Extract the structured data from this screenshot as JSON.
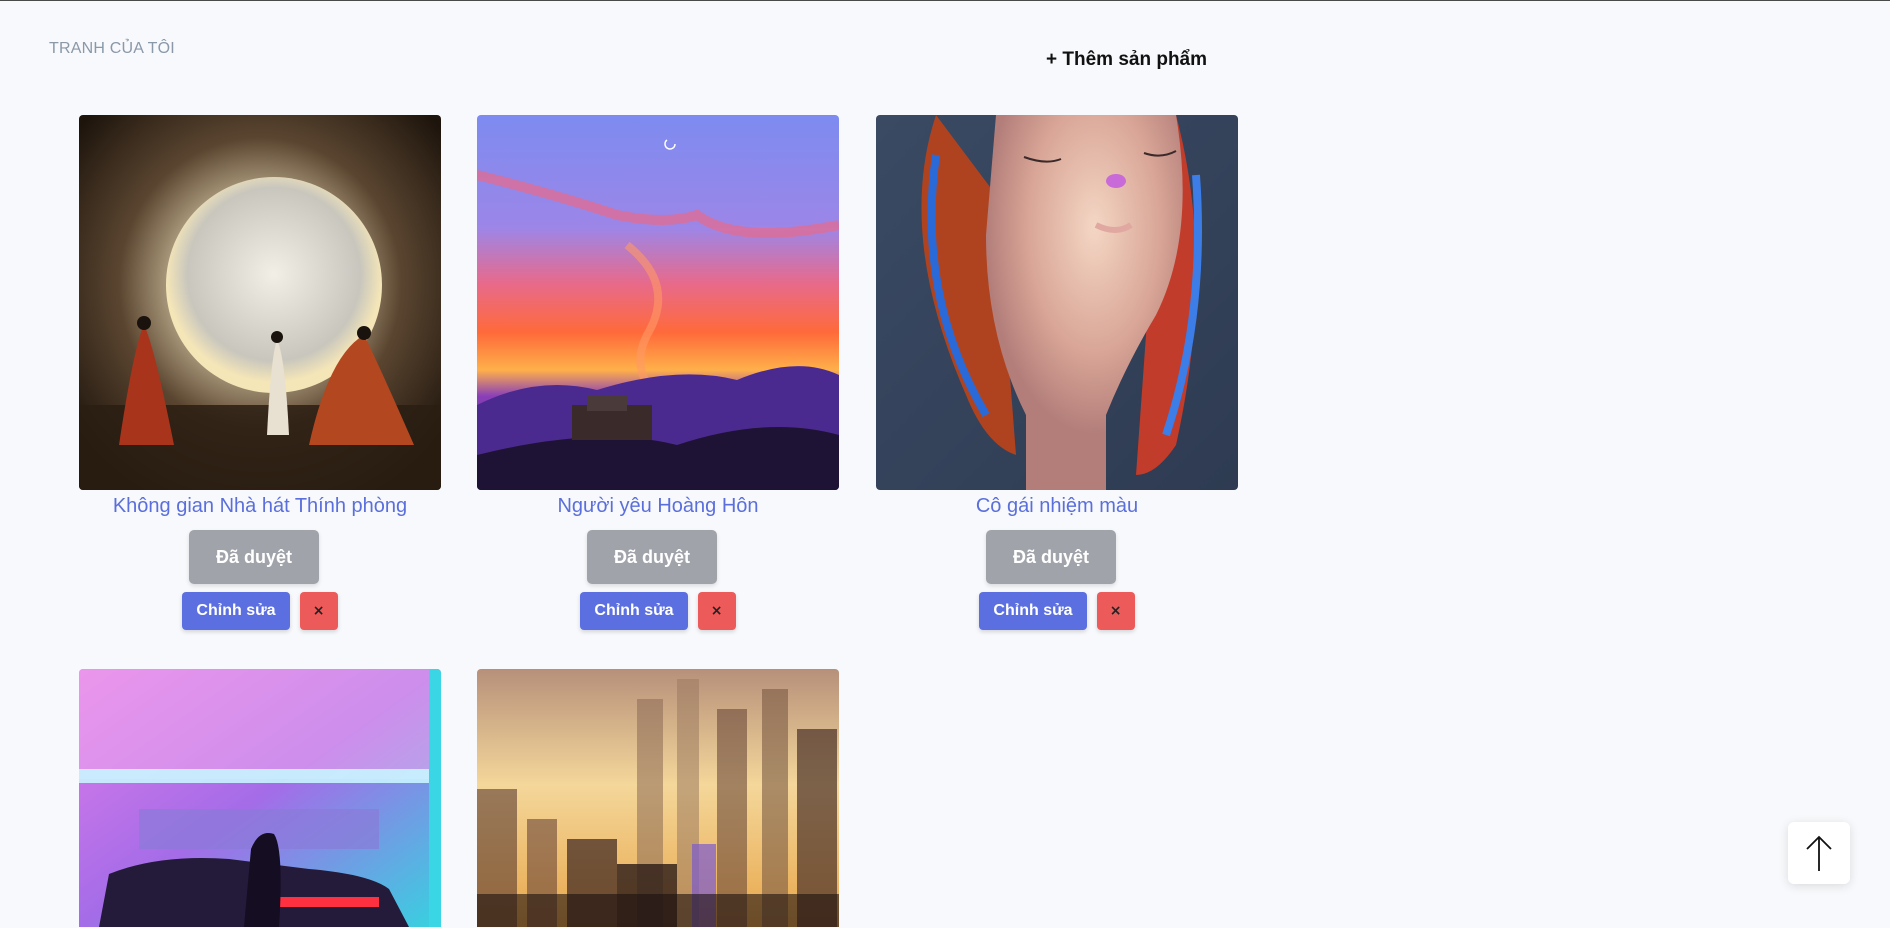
{
  "page": {
    "section_title": "TRANH CỦA TÔI",
    "add_product": "+ Thêm sản phẩm"
  },
  "products": [
    {
      "title": "Không gian Nhà hát Thính phòng",
      "status": "Đã duyệt",
      "edit_label": "Chỉnh sửa",
      "delete_label": "×",
      "image": "opera-hall-moon-painting"
    },
    {
      "title": "Người yêu Hoàng Hôn",
      "status": "Đã duyệt",
      "edit_label": "Chỉnh sửa",
      "delete_label": "×",
      "image": "sunset-sky-truck-painting"
    },
    {
      "title": "Cô gái nhiệm màu",
      "status": "Đã duyệt",
      "edit_label": "Chỉnh sửa",
      "delete_label": "×",
      "image": "girl-portrait-painting"
    },
    {
      "image": "neon-city-car-painting"
    },
    {
      "image": "golden-city-skyline-painting"
    }
  ],
  "colors": {
    "title_link": "#5b6fdc",
    "status_bg": "#a0a4aa",
    "edit_bg": "#5b6fe0",
    "delete_bg": "#ec5a5a",
    "page_bg": "#f7f9fc"
  },
  "scroll_top_icon": "arrow-up-icon"
}
